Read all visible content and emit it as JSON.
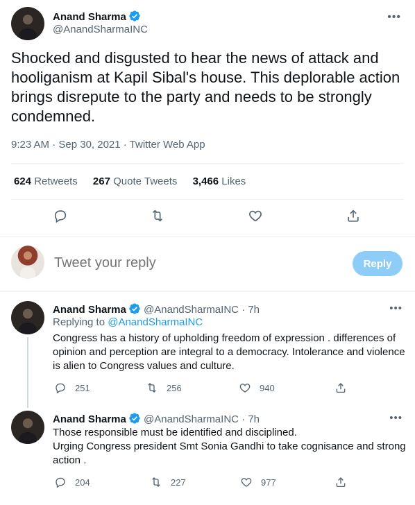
{
  "main_tweet": {
    "author_name": "Anand Sharma",
    "author_handle": "@AnandSharmaINC",
    "more_icon": "more-horizontal-icon",
    "text": "Shocked and disgusted to hear the news of attack and hooliganism at Kapil Sibal's house. This deplorable action  brings disrepute to the party and needs to be strongly condemned.",
    "meta": "9:23 AM · Sep 30, 2021 · Twitter Web App",
    "stats": {
      "retweets_count": "624",
      "retweets_label": "Retweets",
      "quotes_count": "267",
      "quotes_label": "Quote Tweets",
      "likes_count": "3,466",
      "likes_label": "Likes"
    }
  },
  "reply_box": {
    "placeholder": "Tweet your reply",
    "button_label": "Reply"
  },
  "thread": [
    {
      "author_name": "Anand Sharma",
      "author_handle": "@AnandSharmaINC",
      "time": "· 7h",
      "replying_prefix": "Replying to ",
      "replying_to": "@AnandSharmaINC",
      "text": "Congress has a history of upholding freedom of expression . differences of opinion and perception are integral to a democracy. Intolerance and violence is alien to Congress values and culture.",
      "replies": "251",
      "retweets": "256",
      "likes": "940"
    },
    {
      "author_name": "Anand Sharma",
      "author_handle": "@AnandSharmaINC",
      "time": "· 7h",
      "text_line1": "Those responsible must be identified and disciplined.",
      "text_line2": "Urging Congress president Smt Sonia Gandhi to take cognisance and strong action .",
      "replies": "204",
      "retweets": "227",
      "likes": "977"
    }
  ],
  "colors": {
    "accent": "#1d9bf0",
    "reply_button_disabled": "#8ecdf8",
    "secondary_text": "#536471",
    "divider": "#eff3f4"
  }
}
